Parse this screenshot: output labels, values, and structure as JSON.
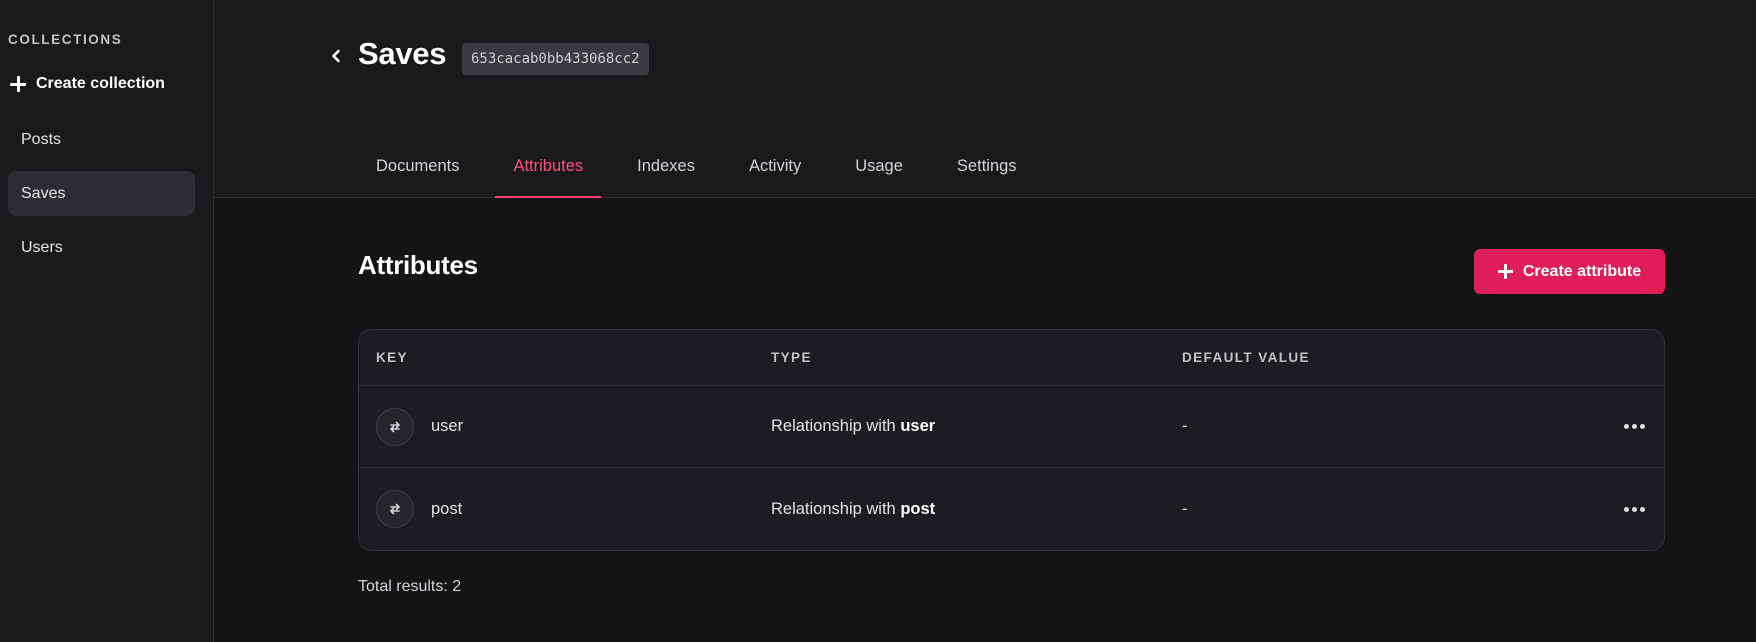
{
  "sidebar": {
    "heading": "COLLECTIONS",
    "create_label": "Create collection",
    "items": [
      {
        "label": "Posts",
        "active": false
      },
      {
        "label": "Saves",
        "active": true
      },
      {
        "label": "Users",
        "active": false
      }
    ]
  },
  "header": {
    "title": "Saves",
    "id_badge": "653cacab0bb433068cc2",
    "back_icon": "chevron-left-icon"
  },
  "tabs": [
    {
      "label": "Documents",
      "active": false
    },
    {
      "label": "Attributes",
      "active": true
    },
    {
      "label": "Indexes",
      "active": false
    },
    {
      "label": "Activity",
      "active": false
    },
    {
      "label": "Usage",
      "active": false
    },
    {
      "label": "Settings",
      "active": false
    }
  ],
  "attributes": {
    "title": "Attributes",
    "create_label": "Create attribute",
    "columns": {
      "key": "KEY",
      "type": "TYPE",
      "default": "DEFAULT VALUE"
    },
    "rows": [
      {
        "key": "user",
        "type_prefix": "Relationship with ",
        "type_target": "user",
        "default": "-"
      },
      {
        "key": "post",
        "type_prefix": "Relationship with ",
        "type_target": "post",
        "default": "-"
      }
    ],
    "total": "Total results: 2"
  },
  "colors": {
    "accent": "#e01e5a",
    "accent_text": "#ff4f7b",
    "background": "#141416",
    "surface": "#1d1d21"
  }
}
